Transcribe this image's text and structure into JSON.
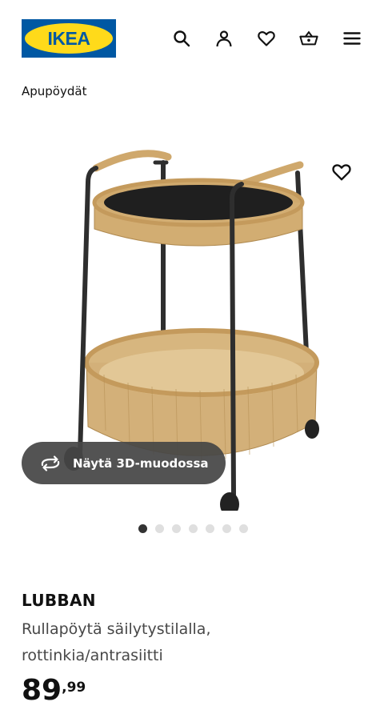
{
  "brand": {
    "logo_text": "IKEA",
    "blue": "#0058a3",
    "yellow": "#ffda1a"
  },
  "header": {
    "icons": [
      "search-icon",
      "account-icon",
      "heart-icon",
      "basket-icon",
      "menu-icon"
    ]
  },
  "breadcrumb": "Apupöydät",
  "gallery": {
    "view_3d_label": "Näytä 3D-muodossa",
    "slide_count": 7,
    "active_slide": 1
  },
  "product": {
    "name": "LUBBAN",
    "description": "Rullapöytä säilytystilalla, rottinkia/antrasiitti",
    "price_integer": "89",
    "price_decimals": ",99"
  }
}
